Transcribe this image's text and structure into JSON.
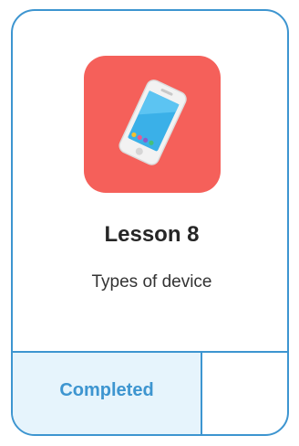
{
  "lesson": {
    "icon": "smartphone-icon",
    "title": "Lesson 8",
    "subtitle": "Types of device",
    "status": "Completed"
  },
  "colors": {
    "border": "#3d95d0",
    "icon_background": "#f5605a",
    "status_background": "#e6f4fc",
    "status_text": "#3d95d0",
    "phone_body": "#f2f2f2",
    "phone_screen": "#3ab0e8"
  }
}
